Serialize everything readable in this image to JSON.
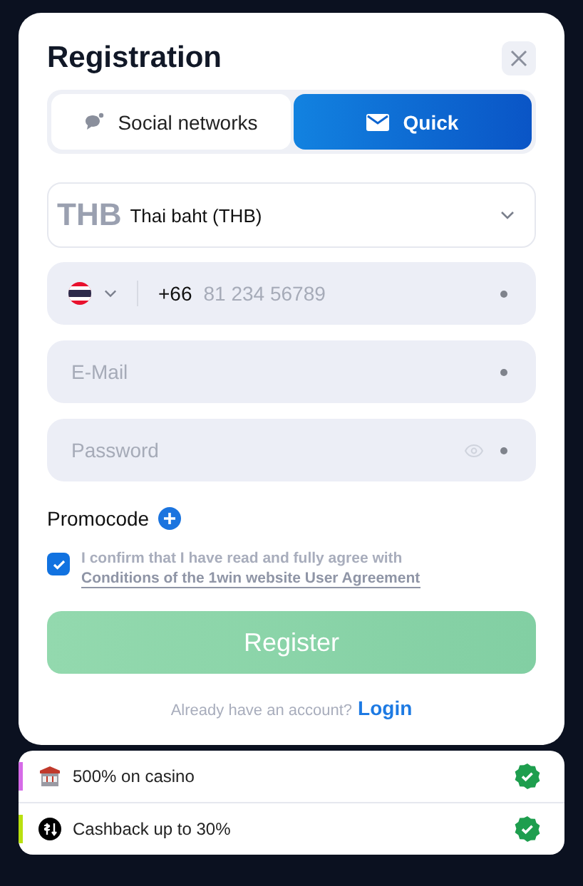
{
  "dialog": {
    "title": "Registration"
  },
  "tabs": [
    {
      "label": "Social networks",
      "kind": "social",
      "selected": false
    },
    {
      "label": "Quick",
      "kind": "mail",
      "selected": true
    }
  ],
  "currency": {
    "code": "THB",
    "name": "Thai baht (THB)"
  },
  "phone": {
    "code": "+66",
    "placeholder": "81 234 56789"
  },
  "fields": [
    {
      "placeholder": "E-Mail",
      "kind": "text"
    },
    {
      "placeholder": "Password",
      "kind": "password"
    }
  ],
  "promocode": {
    "label": "Promocode"
  },
  "agreement": {
    "checked": true,
    "text": "I confirm that I have read and fully agree with",
    "link": "Conditions of the 1win website User Agreement"
  },
  "register_button": {
    "label": "Register",
    "disabled": true
  },
  "login": {
    "prompt": "Already have an account?",
    "link": "Login"
  },
  "bonuses": [
    {
      "label": "500% on casino",
      "kind": "casino",
      "color": "#d66be8"
    },
    {
      "label": "Cashback up to 30%",
      "kind": "cashback",
      "color": "#b9e00f"
    }
  ]
}
